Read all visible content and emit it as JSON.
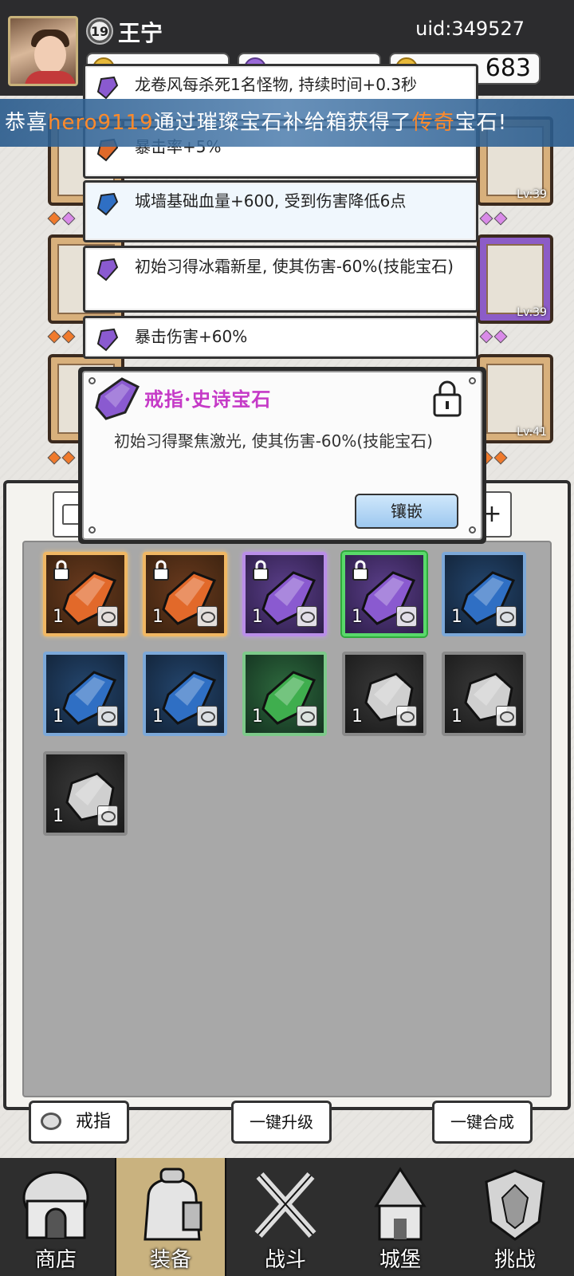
{
  "header": {
    "player_level": "19",
    "player_name": "王宁",
    "uid": "uid:349527",
    "resource_value": "683"
  },
  "broadcast": {
    "prefix": "恭喜",
    "player": "hero9119",
    "middle": "通过璀璨宝石补给箱获得了",
    "rarity": "传奇",
    "suffix": "宝石!"
  },
  "equipment_slots": [
    {
      "level": "Lv:39"
    },
    {
      "level": "Lv:39"
    },
    {
      "level": "Lv:41"
    }
  ],
  "gem_infos": [
    {
      "text": "龙卷风每杀死1名怪物, 持续时间+0.3秒",
      "color": "#8a5ad0"
    },
    {
      "text": "暴击率+5%",
      "color": "#e06a2a"
    },
    {
      "text": "城墙基础血量+600, 受到伤害降低6点",
      "color": "#2f6fc4"
    },
    {
      "text": "初始习得冰霜新星, 使其伤害-60%(技能宝石)",
      "color": "#8a5ad0"
    },
    {
      "text": "暴击伤害+60%",
      "color": "#8a5ad0"
    }
  ],
  "popup": {
    "title": "戒指·史诗宝石",
    "description": "初始习得聚焦激光, 使其伤害-60%(技能宝石)",
    "embed_label": "镶嵌",
    "gem_color": "#8a5ad0"
  },
  "tabs": {
    "right_label": "+"
  },
  "inventory": [
    {
      "quality": "legendary",
      "count": "1",
      "locked": true,
      "color": "#e2692a"
    },
    {
      "quality": "legendary",
      "count": "1",
      "locked": true,
      "color": "#e2692a"
    },
    {
      "quality": "epic",
      "count": "1",
      "locked": true,
      "color": "#8a5ad0"
    },
    {
      "quality": "epic",
      "count": "1",
      "locked": true,
      "color": "#8a5ad0",
      "selected": true
    },
    {
      "quality": "rare",
      "count": "1",
      "locked": false,
      "color": "#2f6fc4"
    },
    {
      "quality": "rare",
      "count": "1",
      "locked": false,
      "color": "#2f6fc4"
    },
    {
      "quality": "rare",
      "count": "1",
      "locked": false,
      "color": "#2f6fc4"
    },
    {
      "quality": "uncommon",
      "count": "1",
      "locked": false,
      "color": "#3fae4e"
    },
    {
      "quality": "common",
      "count": "1",
      "locked": false,
      "color": "#cfcfcf"
    },
    {
      "quality": "common",
      "count": "1",
      "locked": false,
      "color": "#cfcfcf"
    },
    {
      "quality": "common",
      "count": "1",
      "locked": false,
      "color": "#cfcfcf"
    }
  ],
  "actions": {
    "ring_filter": "戒指",
    "upgrade_all": "一键升级",
    "merge_all": "一键合成"
  },
  "nav": [
    {
      "label": "商店",
      "icon": "shop-icon"
    },
    {
      "label": "装备",
      "icon": "bag-icon",
      "active": true
    },
    {
      "label": "战斗",
      "icon": "swords-icon"
    },
    {
      "label": "城堡",
      "icon": "castle-icon"
    },
    {
      "label": "挑战",
      "icon": "challenge-icon"
    }
  ]
}
